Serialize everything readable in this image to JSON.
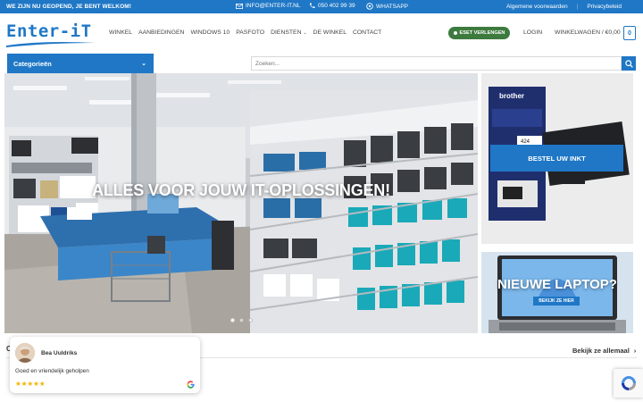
{
  "topbar": {
    "welcome": "WE ZIJN NU GEOPEND, JE BENT WELKOM!",
    "email": "INFO@ENTER-IT.NL",
    "phone": "050 402 99 39",
    "whatsapp": "WHATSAPP",
    "links": [
      "Algemene voorwaarden",
      "Privacybeleid"
    ]
  },
  "header": {
    "logo_text": "Enter-iT",
    "nav": [
      "WINKEL",
      "AANBIEDINGEN",
      "WINDOWS 10",
      "PASFOTO",
      "DIENSTEN",
      "DE WINKEL",
      "CONTACT"
    ],
    "diensten_has_dropdown": true,
    "eset_button": "ESET VERLENGEN",
    "login": "LOGIN",
    "cart": "WINKELWAGEN / €0,00",
    "cart_count": "0"
  },
  "categories": {
    "label": "Categorieën"
  },
  "search": {
    "placeholder": "Zoeken..."
  },
  "hero": {
    "headline": "ALLES VOOR JOUW IT-OPLOSSINGEN!",
    "slides": 3,
    "active_slide": 1
  },
  "banners": {
    "ink": {
      "button": "BESTEL UW INKT",
      "brand": "brother",
      "model": "424"
    },
    "laptop": {
      "title": "NIEUWE LAPTOP?",
      "button": "BEKIJK ZE HIER"
    }
  },
  "section": {
    "title_partial": "C",
    "see_all": "Bekijk ze allemaal"
  },
  "review": {
    "name": "Bea Uuldriks",
    "text": "Goed en vriendelijk geholpen",
    "stars": "★★★★★"
  },
  "colors": {
    "primary": "#1f77c6",
    "eset_green": "#3d7a3e",
    "star": "#f4b400"
  }
}
